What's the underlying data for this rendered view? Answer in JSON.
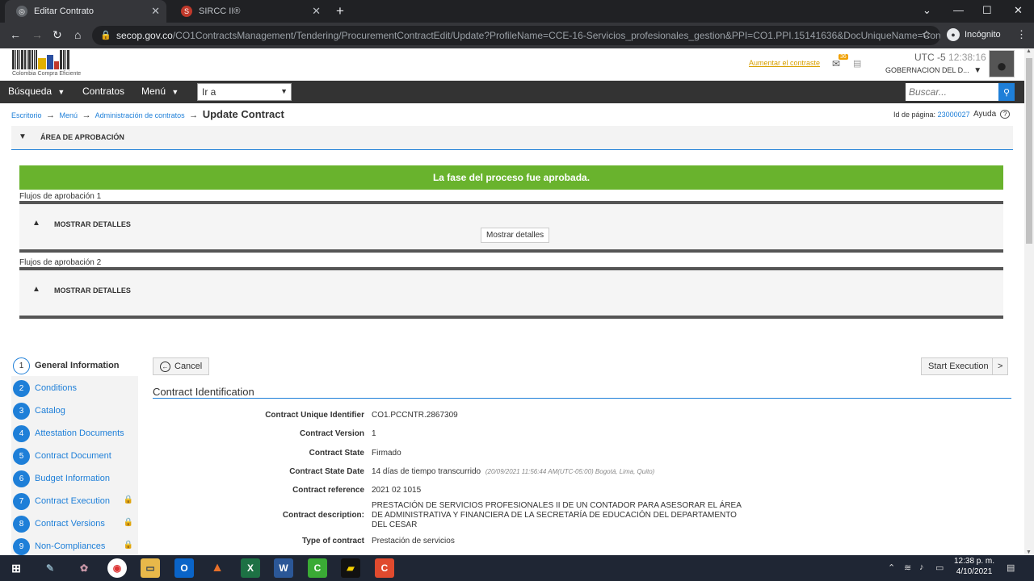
{
  "browser": {
    "tabs": [
      {
        "title": "Editar Contrato",
        "active": true
      },
      {
        "title": "SIRCC II®",
        "active": false
      }
    ],
    "url_host": "secop.gov.co",
    "url_path": "/CO1ContractsManagement/Tendering/ProcurementContractEdit/Update?ProfileName=CCE-16-Servicios_profesionales_gestion&PPI=CO1.PPI.15141636&DocUniqueName=Con...",
    "incognito_label": "Incógnito"
  },
  "header": {
    "logo_text": "Colombia Compra Eficiente",
    "contrast_link": "Aumentar el contraste",
    "mail_count": "36",
    "utc_label": "UTC -5",
    "time": "12:38:16",
    "entity": "GOBERNACION DEL D..."
  },
  "menu": {
    "busqueda": "Búsqueda",
    "contratos": "Contratos",
    "menu": "Menú",
    "goto": "Ir a",
    "search_placeholder": "Buscar..."
  },
  "breadcrumb": {
    "items": [
      "Escritorio",
      "Menú",
      "Administración de contratos"
    ],
    "current": "Update Contract",
    "page_id_label": "Id de página:",
    "page_id": "23000027",
    "help": "Ayuda"
  },
  "approval": {
    "header": "ÁREA DE APROBACIÓN",
    "banner": "La fase del proceso fue aprobada.",
    "flow1_label": "Flujos de aprobación 1",
    "flow2_label": "Flujos de aprobación 2",
    "show_details": "MOSTRAR DETALLES",
    "tooltip": "Mostrar detalles"
  },
  "steps": [
    {
      "num": "1",
      "label": "General Information",
      "locked": false
    },
    {
      "num": "2",
      "label": "Conditions",
      "locked": false
    },
    {
      "num": "3",
      "label": "Catalog",
      "locked": false
    },
    {
      "num": "4",
      "label": "Attestation Documents",
      "locked": false
    },
    {
      "num": "5",
      "label": "Contract Document",
      "locked": false
    },
    {
      "num": "6",
      "label": "Budget Information",
      "locked": false
    },
    {
      "num": "7",
      "label": "Contract Execution",
      "locked": true
    },
    {
      "num": "8",
      "label": "Contract Versions",
      "locked": true
    },
    {
      "num": "9",
      "label": "Non-Compliances",
      "locked": true
    }
  ],
  "actions": {
    "cancel": "Cancel",
    "start": "Start Execution",
    "next": ">"
  },
  "contract": {
    "section_title": "Contract Identification",
    "fields": [
      {
        "label": "Contract Unique Identifier",
        "value": "CO1.PCCNTR.2867309"
      },
      {
        "label": "Contract Version",
        "value": "1"
      },
      {
        "label": "Contract State",
        "value": "Firmado"
      },
      {
        "label": "Contract State Date",
        "value": "14 días de tiempo transcurrido",
        "meta": "(20/09/2021 11:56:44 AM(UTC-05:00) Bogotá, Lima, Quito)"
      },
      {
        "label": "Contract reference",
        "value": "2021 02 1015"
      },
      {
        "label": "Contract description:",
        "value": "PRESTACIÓN DE SERVICIOS PROFESIONALES II DE UN CONTADOR PARA ASESORAR EL ÁREA DE ADMINISTRATIVA Y FINANCIERA DE LA SECRETARÍA DE EDUCACIÓN DEL DEPARTAMENTO DEL CESAR"
      },
      {
        "label": "Type of contract",
        "value": "Prestación de servicios"
      }
    ]
  },
  "taskbar": {
    "time": "12:38 p. m.",
    "date": "4/10/2021"
  }
}
